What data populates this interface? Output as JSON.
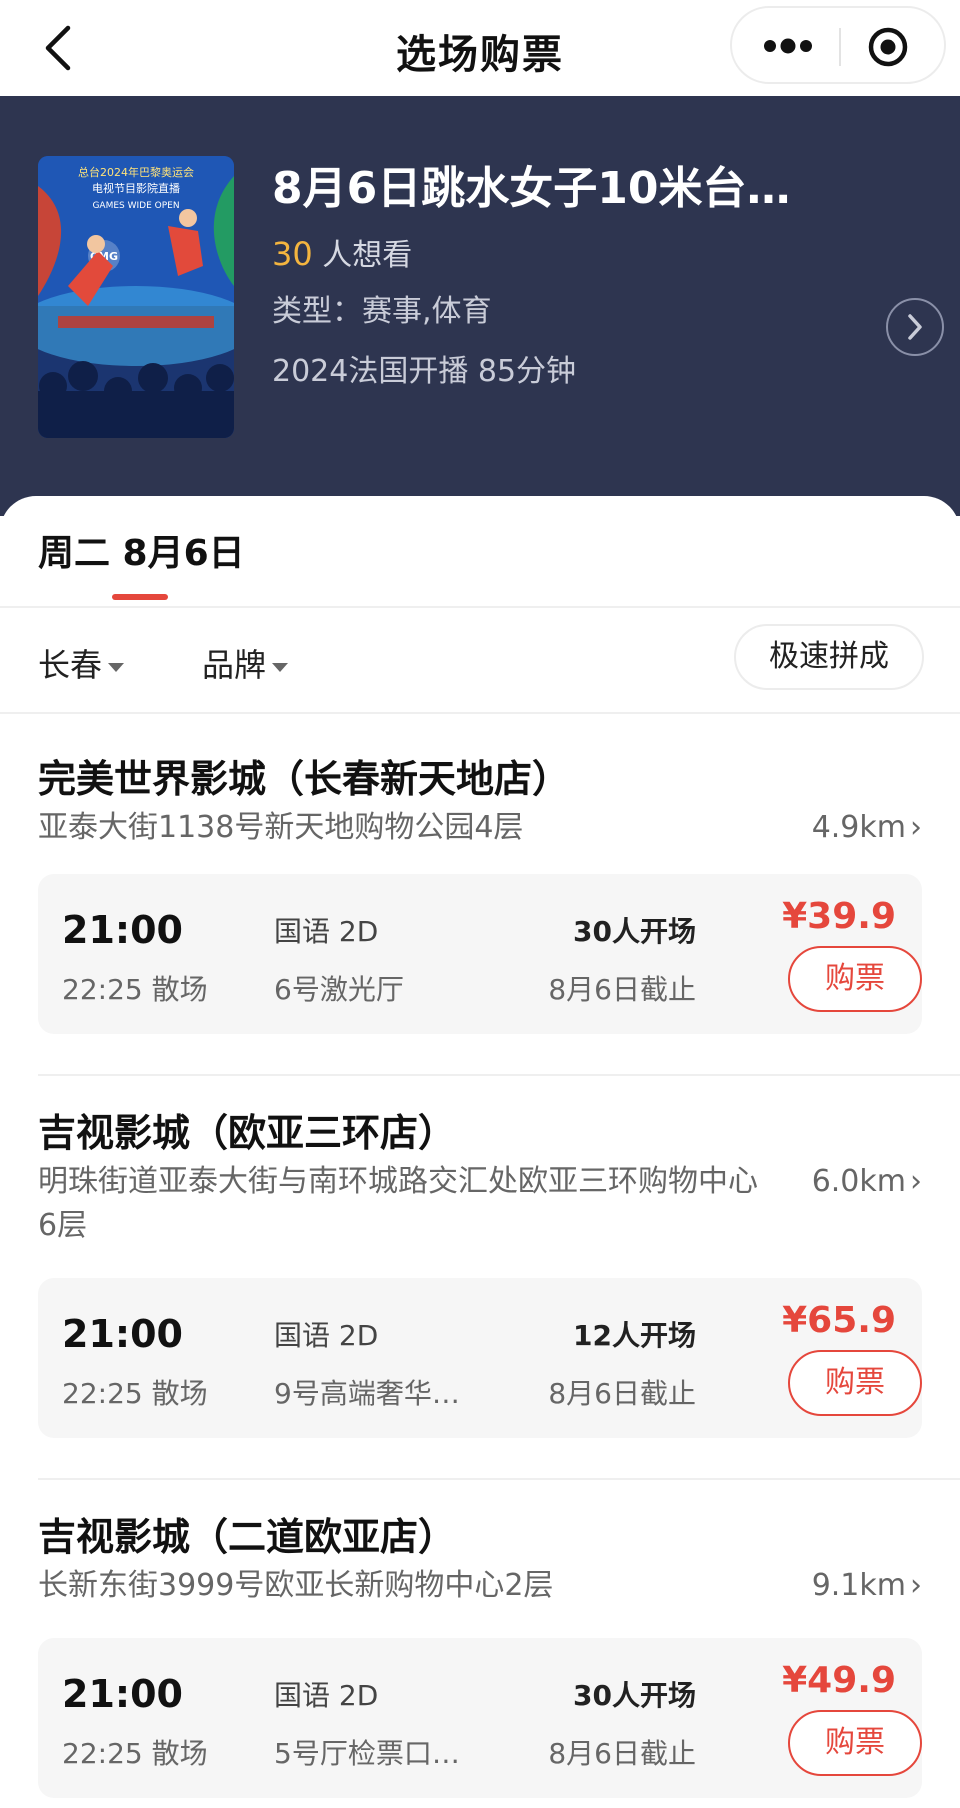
{
  "nav": {
    "title": "选场购票"
  },
  "movie": {
    "title": "8月6日跳水女子10米台…",
    "want_count": "30",
    "want_suffix": " 人想看",
    "genre": "类型：赛事,体育",
    "info": "2024法国开播 85分钟",
    "poster_text_line1": "总台2024年巴黎奥运会",
    "poster_text_line2": "电视节目影院直播",
    "poster_text_line3": "GAMES WIDE OPEN",
    "poster_logo": "CMG"
  },
  "date_tab": {
    "label": "周二 8月6日"
  },
  "filters": {
    "city": "长春",
    "brand": "品牌",
    "quick": "极速拼成"
  },
  "cinemas": [
    {
      "name": "完美世界影城（长春新天地店）",
      "address": "亚泰大街1138号新天地购物公园4层",
      "distance": "4.9km",
      "show": {
        "start": "21:00",
        "end": "22:25 散场",
        "lang": "国语 2D",
        "hall": "6号激光厅",
        "min": "30人开场",
        "deadline": "8月6日截止",
        "price": "¥39.9",
        "buy": "购票"
      }
    },
    {
      "name": "吉视影城（欧亚三环店）",
      "address": "明珠街道亚泰大街与南环城路交汇处欧亚三环购物中心6层",
      "distance": "6.0km",
      "show": {
        "start": "21:00",
        "end": "22:25 散场",
        "lang": "国语 2D",
        "hall": "9号高端奢华…",
        "min": "12人开场",
        "deadline": "8月6日截止",
        "price": "¥65.9",
        "buy": "购票"
      }
    },
    {
      "name": "吉视影城（二道欧亚店）",
      "address": "长新东街3999号欧亚长新购物中心2层",
      "distance": "9.1km",
      "show": {
        "start": "21:00",
        "end": "22:25 散场",
        "lang": "国语 2D",
        "hall": "5号厅检票口…",
        "min": "30人开场",
        "deadline": "8月6日截止",
        "price": "¥49.9",
        "buy": "购票"
      }
    }
  ],
  "colors": {
    "accent": "#e5473c",
    "hero_bg": "#2e3550",
    "want_count": "#f4b53f"
  }
}
